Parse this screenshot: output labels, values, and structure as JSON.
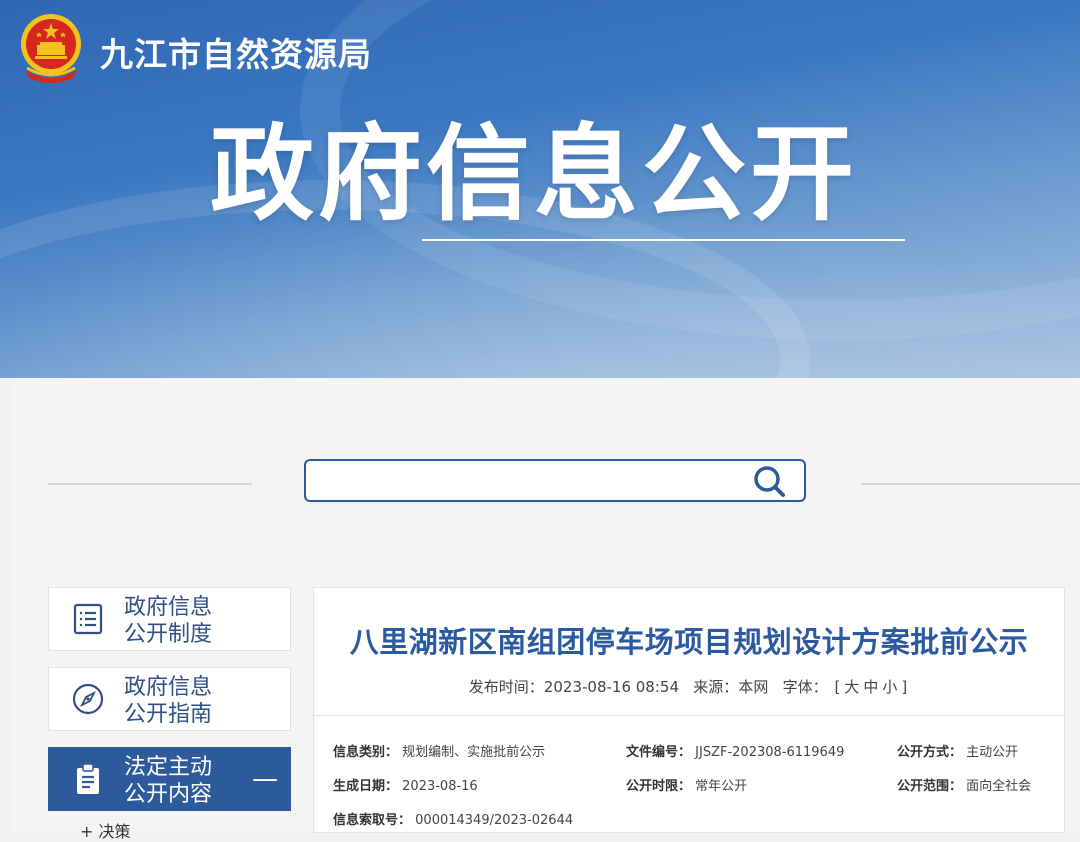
{
  "header": {
    "site_title": "九江市自然资源局",
    "hero_title": "政府信息公开"
  },
  "search": {
    "placeholder": ""
  },
  "sidebar": {
    "items": [
      {
        "label_line1": "政府信息",
        "label_line2": "公开制度",
        "icon": "list-icon"
      },
      {
        "label_line1": "政府信息",
        "label_line2": "公开指南",
        "icon": "compass-icon"
      },
      {
        "label_line1": "法定主动",
        "label_line2": "公开内容",
        "icon": "clipboard-icon",
        "toggle": "—",
        "active": true
      }
    ],
    "sub_item": "+ 决策"
  },
  "article": {
    "title": "八里湖新区南组团停车场项目规划设计方案批前公示",
    "publish_label": "发布时间：",
    "publish_time": "2023-08-16 08:54",
    "source_label": "来源：",
    "source": "本网",
    "font_label": "字体：",
    "font_open": "[",
    "font_large": "大",
    "font_medium": "中",
    "font_small": "小",
    "font_close": "]",
    "info": {
      "category_label": "信息类别：",
      "category": "规划编制、实施批前公示",
      "doc_no_label": "文件编号：",
      "doc_no": "JJSZF-202308-6119649",
      "method_label": "公开方式：",
      "method": "主动公开",
      "date_label": "生成日期：",
      "date": "2023-08-16",
      "period_label": "公开时限：",
      "period": "常年公开",
      "scope_label": "公开范围：",
      "scope": "面向全社会",
      "index_label": "信息索取号：",
      "index": "000014349/2023-02644"
    }
  },
  "colors": {
    "primary": "#2c5a9a",
    "title": "#2c5aa0",
    "emblem_red": "#d7261d",
    "emblem_gold": "#f4c21c"
  }
}
